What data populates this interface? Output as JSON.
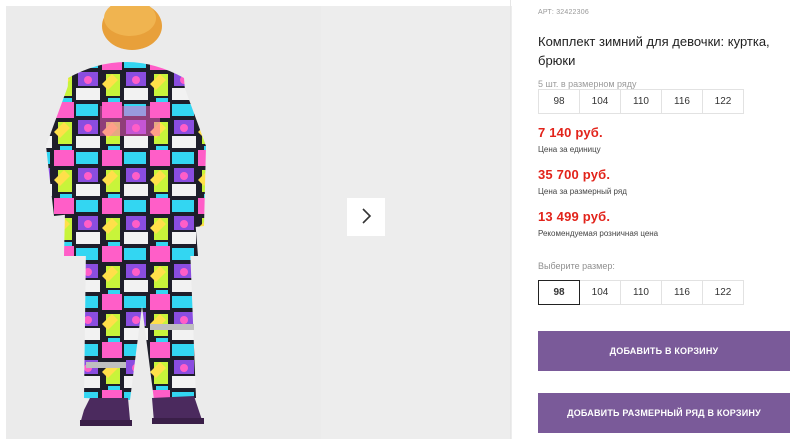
{
  "product": {
    "article": "АРТ: 32422306",
    "title": "Комплект зимний для девочки: куртка, брюки"
  },
  "pack": {
    "label": "5 шт. в размерном ряду",
    "sizes": [
      "98",
      "104",
      "110",
      "116",
      "122"
    ]
  },
  "prices": {
    "unit": {
      "value": "7 140 руб.",
      "label": "Цена за единицу"
    },
    "pack": {
      "value": "35 700 руб.",
      "label": "Цена за размерный ряд"
    },
    "retail": {
      "value": "13 499 руб.",
      "label": "Рекомендуемая розничная цена"
    }
  },
  "size_select": {
    "label": "Выберите размер:",
    "sizes": [
      "98",
      "104",
      "110",
      "116",
      "122"
    ],
    "selected": "98"
  },
  "buttons": {
    "add_to_cart": "ДОБАВИТЬ В КОРЗИНУ",
    "add_pack_to_cart": "ДОБАВИТЬ РАЗМЕРНЫЙ РЯД В КОРЗИНУ"
  },
  "icons": {
    "next": "chevron-right-icon"
  },
  "colors": {
    "price": "#e2231a",
    "button": "#7a5a99",
    "photo_background": "#ebebeb"
  }
}
